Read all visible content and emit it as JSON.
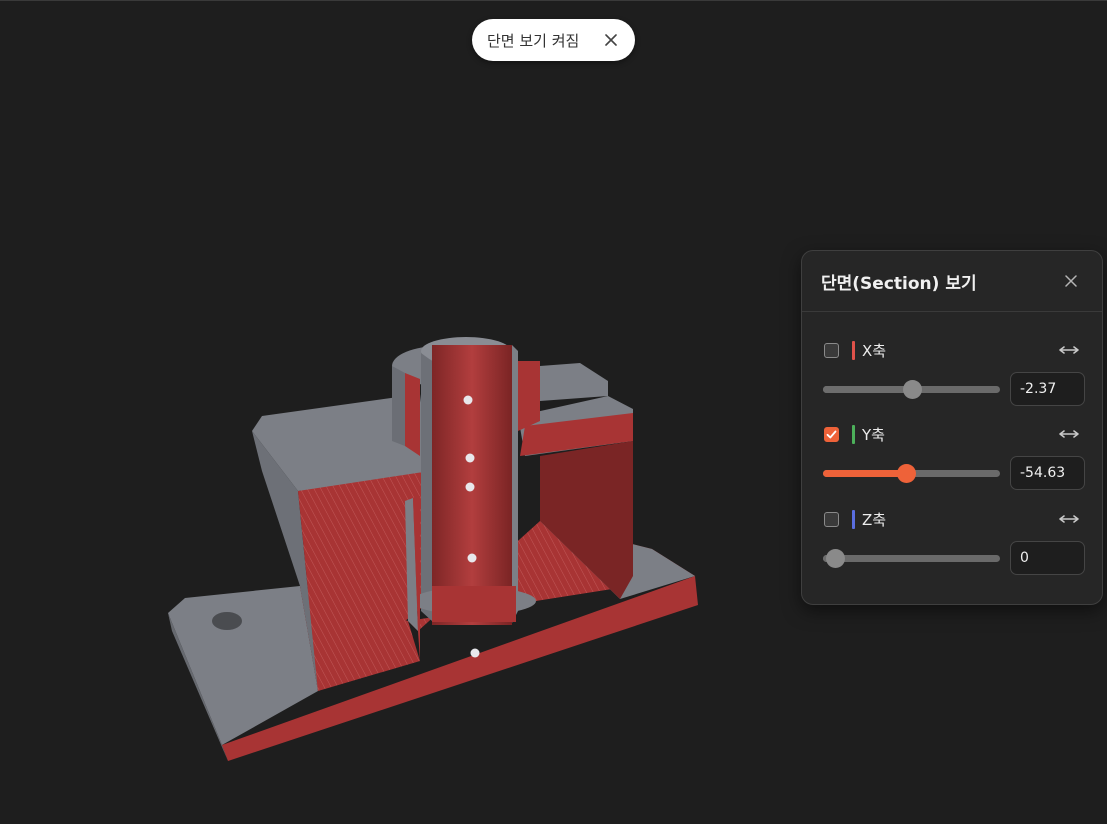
{
  "toast": {
    "message": "단면 보기 켜짐",
    "close_icon": "close-icon"
  },
  "panel": {
    "title": "단면(Section) 보기",
    "close_icon": "close-icon",
    "axes": [
      {
        "label": "X축",
        "checked": false,
        "value": "-2.37",
        "slider_fraction": 0.5,
        "color": "#e0524a",
        "active_color": "#6d6d6d",
        "thumb_color": "#8a8a8a"
      },
      {
        "label": "Y축",
        "checked": true,
        "value": "-54.63",
        "slider_fraction": 0.47,
        "color": "#4cb05a",
        "active_color": "#ee6239",
        "thumb_color": "#ee6239"
      },
      {
        "label": "Z축",
        "checked": false,
        "value": "0",
        "slider_fraction": 0.07,
        "color": "#5a6ee0",
        "active_color": "#6d6d6d",
        "thumb_color": "#8a8a8a"
      }
    ],
    "flip_icon": "flip-direction-icon"
  },
  "colors": {
    "background": "#1e1e1e",
    "panel": "#262626",
    "section_cut": "#a83434",
    "model_gray": "#7c7f86",
    "accent": "#ee6239"
  }
}
